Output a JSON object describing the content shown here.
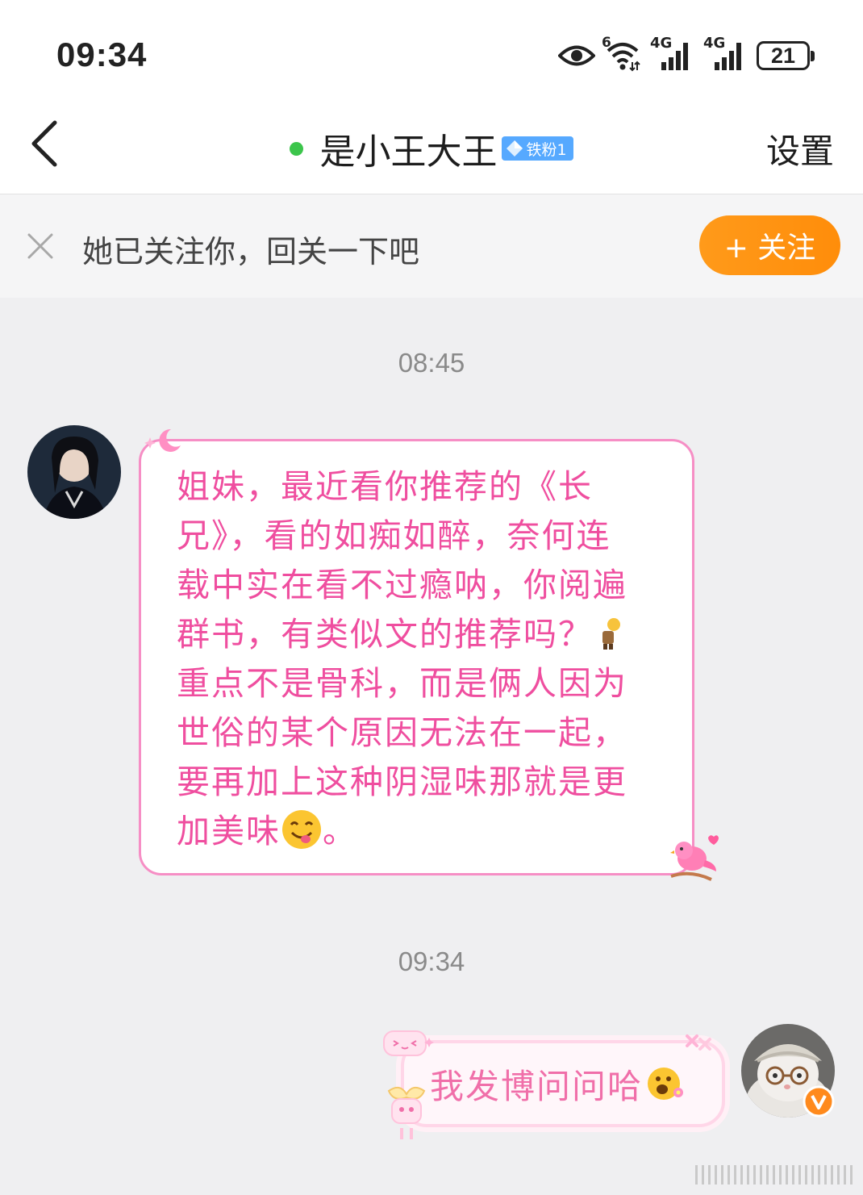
{
  "status_bar": {
    "time": "09:34",
    "battery": "21",
    "wifi_label": "6",
    "signal_1": "4G",
    "signal_2": "4G",
    "icons": [
      "eye-icon",
      "wifi-icon",
      "signal-icon",
      "signal-icon",
      "battery-icon"
    ]
  },
  "header": {
    "contact_name": "是小王大王",
    "fan_badge": "铁粉1",
    "settings": "设置",
    "online_color": "#3cc54b"
  },
  "follow_bar": {
    "text": "她已关注你，回关一下吧",
    "button": "+ 关注",
    "button_color": "#ff9a1a"
  },
  "messages": [
    {
      "time": "08:45",
      "sender": "contact",
      "lines": [
        "姐妹，最近看你推荐的《长",
        "兄》，看的如痴如醉，奈何连",
        "载中实在看不过瘾呐，你阅遍",
        "群书，有类似文的推荐吗？",
        "重点不是骨科，而是俩人因为",
        "世俗的某个原因无法在一起，",
        "要再加上这种阴湿味那就是更",
        "加美味"
      ],
      "last_suffix": "。",
      "text_color": "#ef4e9f"
    },
    {
      "time": "09:34",
      "sender": "me",
      "text": "我发博问问哈",
      "text_color": "#f06fa9"
    }
  ]
}
